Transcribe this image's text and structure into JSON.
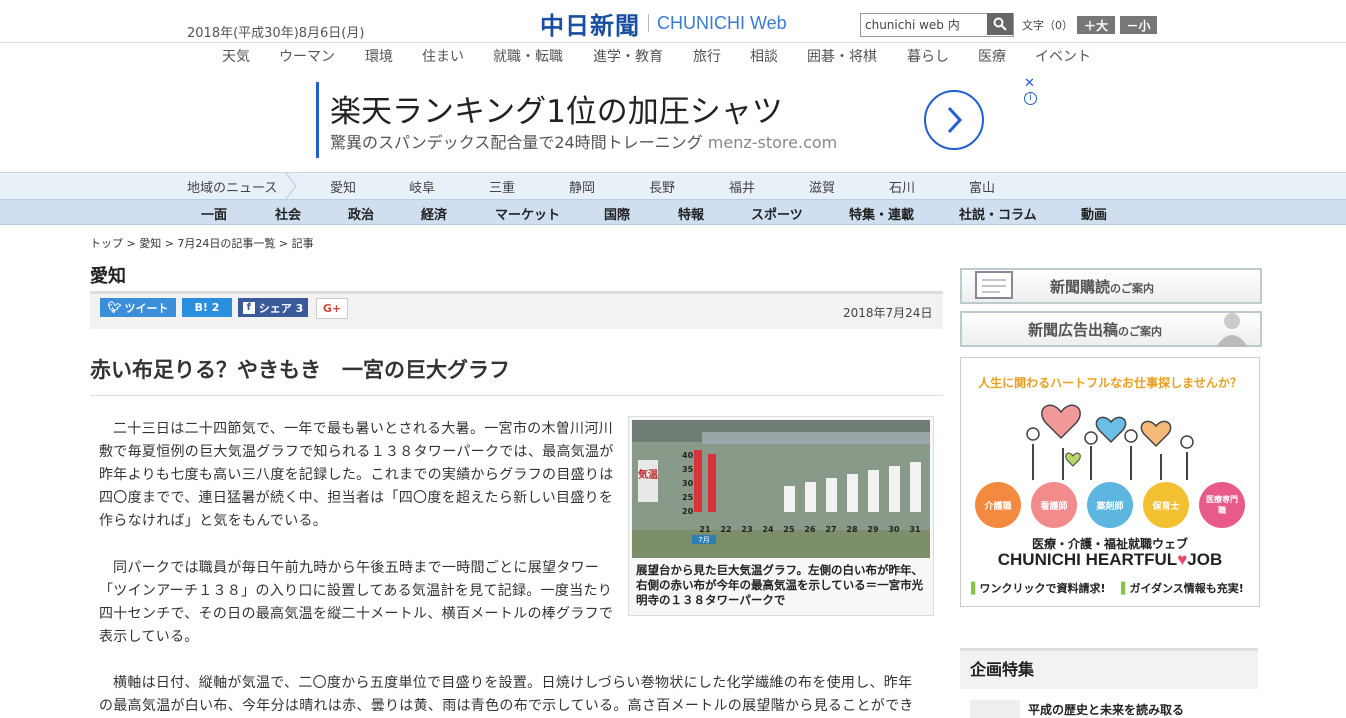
{
  "header": {
    "date": "2018年(平成30年)8月6日(月)",
    "logo_jp": "中日新聞",
    "logo_en": "CHUNICHI Web",
    "search_value": "chunichi web 内",
    "font_size_label": "文字（0）",
    "font_larger": "＋大",
    "font_smaller": "－小"
  },
  "top_nav": [
    "天気",
    "ウーマン",
    "環境",
    "住まい",
    "就職・転職",
    "進学・教育",
    "旅行",
    "相談",
    "囲碁・将棋",
    "暮らし",
    "医療",
    "イベント"
  ],
  "ad": {
    "headline": "楽天ランキング1位の加圧シャツ",
    "sub": "驚異のスパンデックス配合量で24時間トレーニング",
    "domain": "menz-store.com",
    "close": "✕",
    "info": "i"
  },
  "regional_nav": {
    "label": "地域のニュース",
    "items": [
      "愛知",
      "岐阜",
      "三重",
      "静岡",
      "長野",
      "福井",
      "滋賀",
      "石川",
      "富山"
    ]
  },
  "category_nav": [
    "一面",
    "社会",
    "政治",
    "経済",
    "マーケット",
    "国際",
    "特報",
    "スポーツ",
    "特集・連載",
    "社説・コラム",
    "動画"
  ],
  "breadcrumb": "トップ > 愛知 > 7月24日の記事一覧 > 記事",
  "section_title": "愛知",
  "share": {
    "tweet": "ツイート",
    "hatena": "B! 2",
    "facebook": "シェア 3",
    "gplus": "G+"
  },
  "pub_date": "2018年7月24日",
  "article": {
    "title": "赤い布足りる？やきもき　一宮の巨大グラフ",
    "p1": "二十三日は二十四節気で、一年で最も暑いとされる大暑。一宮市の木曽川河川敷で毎夏恒例の巨大気温グラフで知られる１３８タワーパークでは、最高気温が昨年よりも七度も高い三八度を記録した。これまでの実績からグラフの目盛りは四〇度までで、連日猛暑が続く中、担当者は「四〇度を超えたら新しい目盛りを作らなければ」と気をもんでいる。",
    "p2": "同パークでは職員が毎日午前九時から午後五時まで一時間ごとに展望タワー「ツインアーチ１３８」の入り口に設置してある気温計を見て記録。一度当たり四十センチで、その日の最高気温を縦二十メートル、横百メートルの棒グラフで表示している。",
    "p3": "横軸は日付、縦軸が気温で、二〇度から五度単位で目盛りを設置。日焼けしづらい巻物状にした化学繊維の布を使用し、昨年の最高気温が白い布、今年分は晴れは赤、曇りは黄、雨は青色の布で示している。高さ百メートルの展望階から見ることができ",
    "caption": "展望台から見た巨大気温グラフ。左側の白い布が昨年、右側の赤い布が今年の最高気温を示している＝一宮市光明寺の１３８タワーパークで",
    "photo_axis": [
      "40",
      "35",
      "30",
      "25",
      "20"
    ],
    "photo_days": [
      "21",
      "22",
      "23",
      "24",
      "25",
      "26",
      "27",
      "28",
      "29",
      "30",
      "31"
    ],
    "photo_label": "気温",
    "photo_month": "7月"
  },
  "sidebar": {
    "subscribe": "新聞購読",
    "subscribe_small": "のご案内",
    "ad_listing": "新聞広告出稿",
    "ad_listing_small": "のご案内",
    "heartful_top": "人生に関わるハートフルなお仕事探しませんか？",
    "heartful_jobs": [
      "介護職",
      "看護師",
      "薬剤師",
      "保育士",
      "医療専門職"
    ],
    "heartful_sub": "医療・介護・福祉就職ウェブ",
    "heartful_brand": "CHUNICHI HEARTFUL",
    "heartful_job": "JOB",
    "heartful_cta1": "ワンクリックで資料請求!",
    "heartful_cta2": "ガイダンス情報も充実!",
    "kikaku_title": "企画特集",
    "kikaku_item": "平成の歴史と未来を読み取る"
  },
  "colors": {
    "brand_blue": "#1a4fa0",
    "ad_blue": "#1f5fd1",
    "twitter": "#3a8fd8",
    "hatena": "#2a8fdc",
    "facebook": "#3b5a9a"
  }
}
